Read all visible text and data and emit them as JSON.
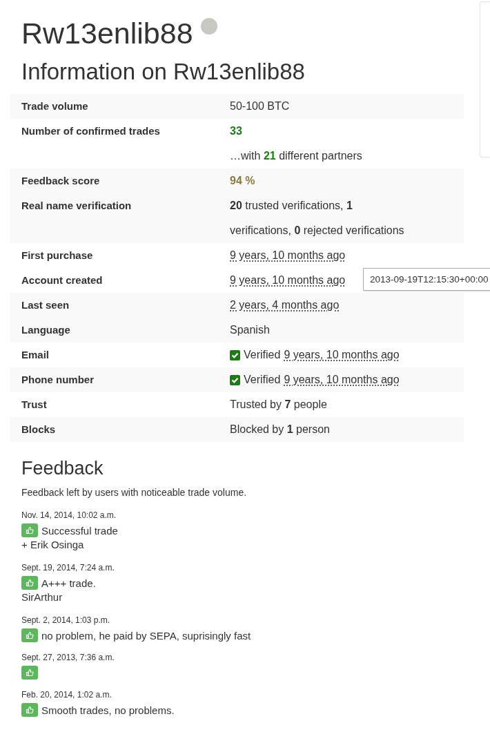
{
  "profile": {
    "username": "Rw13enlib88",
    "online": false
  },
  "info": {
    "title": "Information on Rw13enlib88",
    "groups": [
      {
        "rows": [
          {
            "label": "Trade volume",
            "kind": "text",
            "lines": [
              "50-100 BTC"
            ]
          }
        ]
      },
      {
        "rows": [
          {
            "label": "Number of confirmed trades",
            "kind": "count",
            "lines": [
              "33",
              "…with **21** different partners"
            ]
          }
        ]
      },
      {
        "rows": [
          {
            "label": "Feedback score",
            "kind": "score",
            "lines": [
              "94 %"
            ]
          },
          {
            "label": "Real name verification",
            "kind": "text",
            "lines": [
              "**20** trusted verifications, **1**",
              "verifications, **0** rejected verifications"
            ]
          }
        ]
      },
      {
        "rows": [
          {
            "label": "First purchase",
            "kind": "time",
            "lines": [
              "9 years, 10 months ago"
            ]
          },
          {
            "label": "Account created",
            "kind": "time",
            "lines": [
              "9 years, 10 months ago"
            ],
            "tooltip": "2013-09-19T12:15:30+00:00"
          }
        ]
      },
      {
        "rows": [
          {
            "label": "Last seen",
            "kind": "time",
            "lines": [
              "2 years, 4 months ago"
            ]
          },
          {
            "label": "Language",
            "kind": "text",
            "lines": [
              "Spanish"
            ]
          }
        ]
      },
      {
        "rows": [
          {
            "label": "Email",
            "kind": "verified",
            "checked": true,
            "status": "Verified",
            "lines": [
              "9 years, 10 months ago"
            ]
          }
        ]
      },
      {
        "rows": [
          {
            "label": "Phone number",
            "kind": "verified",
            "checked": true,
            "status": "Verified",
            "lines": [
              "9 years, 10 months ago"
            ]
          }
        ]
      },
      {
        "rows": [
          {
            "label": "Trust",
            "kind": "text",
            "lines": [
              "Trusted by **7** people"
            ]
          }
        ]
      },
      {
        "rows": [
          {
            "label": "Blocks",
            "kind": "text",
            "lines": [
              "Blocked by **1** person"
            ]
          }
        ]
      }
    ]
  },
  "feedback": {
    "title": "Feedback",
    "description": "Feedback left by users with noticeable trade volume.",
    "entries": [
      {
        "date": "Nov. 14, 2014, 10:02 a.m.",
        "positive": true,
        "comment": "Successful trade",
        "author": "+ Erik Osinga"
      },
      {
        "date": "Sept. 19, 2014, 7:24 a.m.",
        "positive": true,
        "comment": "A+++ trade.",
        "author": "SirArthur"
      },
      {
        "date": "Sept. 2, 2014, 1:03 p.m.",
        "positive": true,
        "comment": "no problem, he paid by SEPA, suprisingly fast"
      },
      {
        "date": "Sept. 27, 2013, 7:36 a.m.",
        "positive": true
      },
      {
        "date": "Feb. 20, 2014, 1:02 a.m.",
        "positive": true,
        "comment": "Smooth trades, no problems."
      }
    ]
  }
}
